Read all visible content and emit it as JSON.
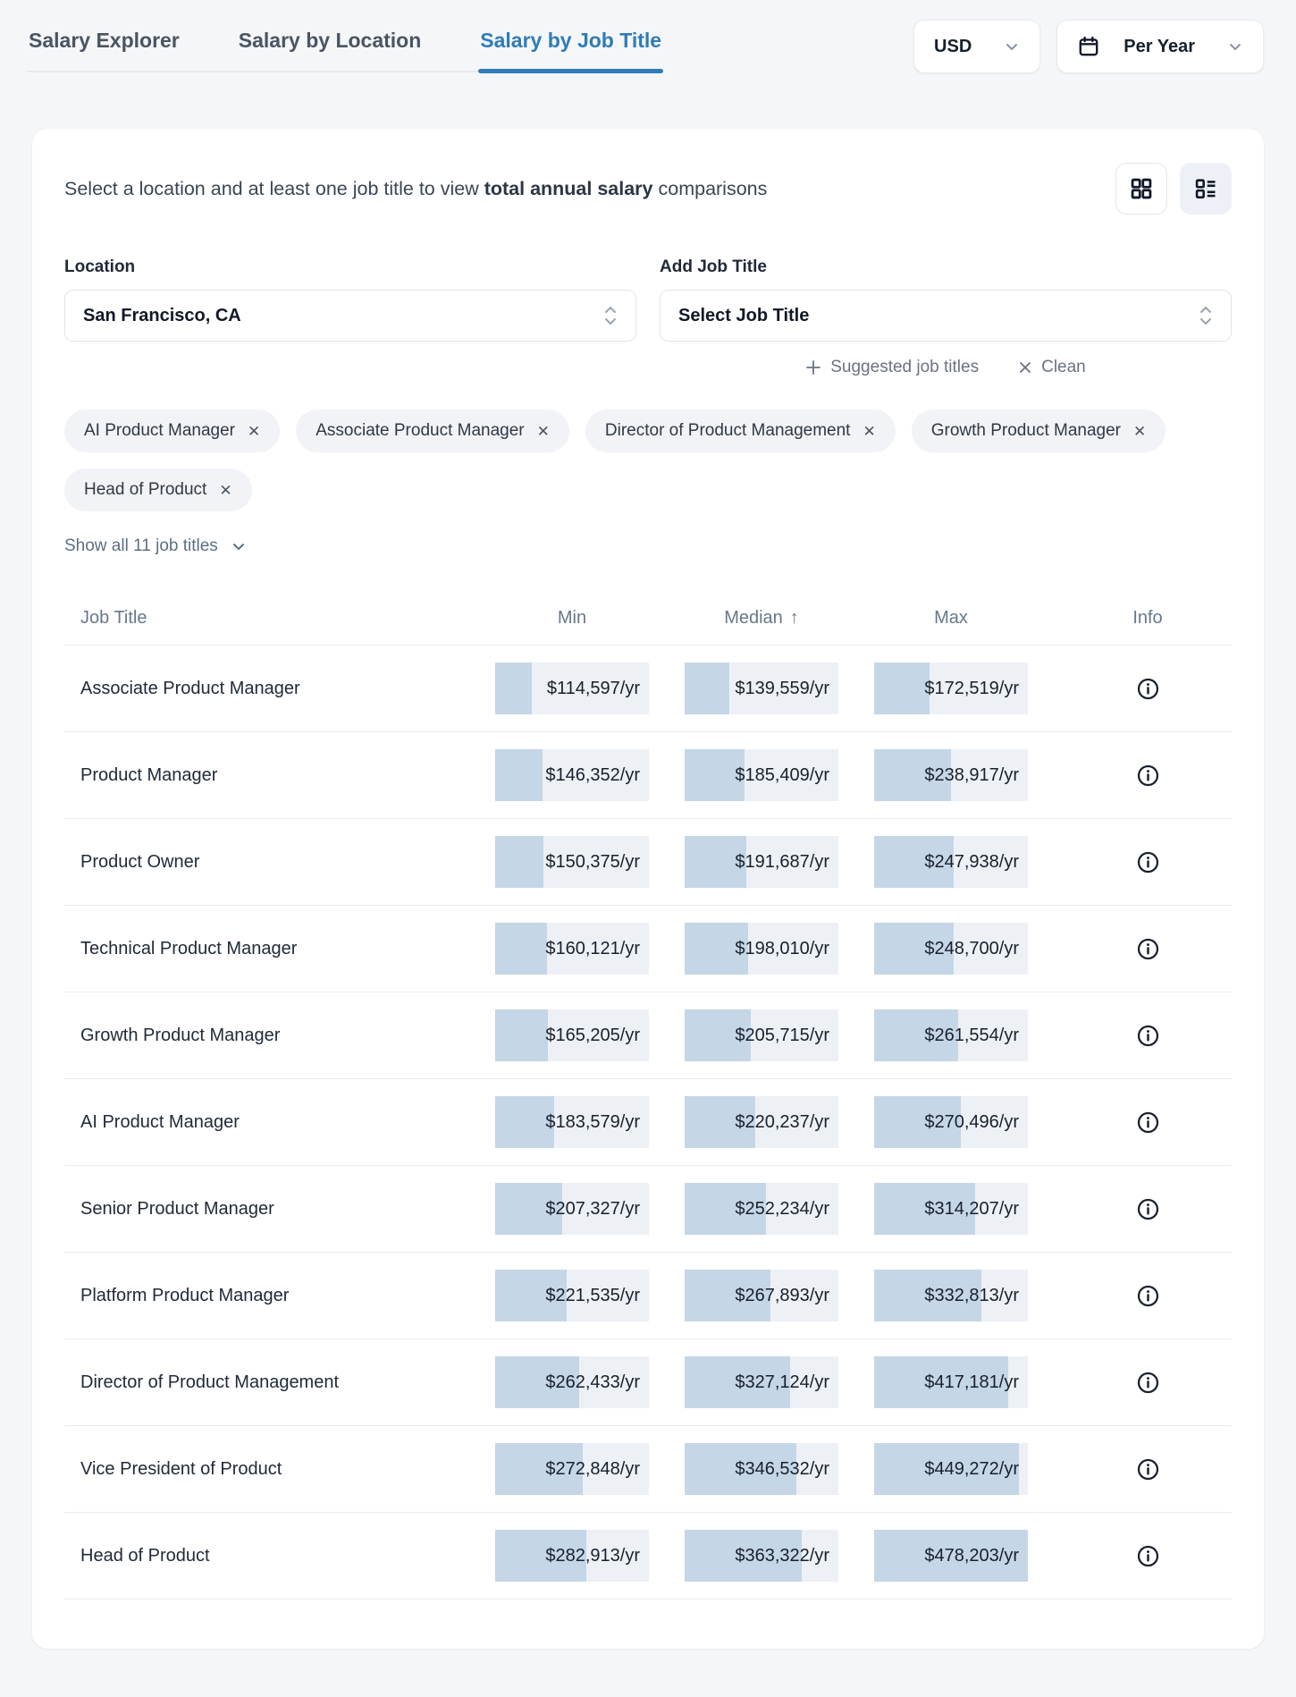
{
  "tabs": [
    {
      "label": "Salary Explorer",
      "active": false
    },
    {
      "label": "Salary by Location",
      "active": false
    },
    {
      "label": "Salary by Job Title",
      "active": true
    }
  ],
  "currency_select": {
    "value": "USD"
  },
  "period_select": {
    "value": "Per Year"
  },
  "intro": {
    "prefix": "Select a location and at least one job title to view ",
    "bold": "total annual salary",
    "suffix": " comparisons"
  },
  "filters": {
    "location": {
      "label": "Location",
      "value": "San Francisco, CA"
    },
    "job_title": {
      "label": "Add Job Title",
      "placeholder": "Select Job Title"
    },
    "suggested_link": "Suggested job titles",
    "clean_link": "Clean",
    "chips": [
      "AI Product Manager",
      "Associate Product Manager",
      "Director of Product Management",
      "Growth Product Manager",
      "Head of Product"
    ],
    "show_all": "Show all 11 job titles"
  },
  "table": {
    "columns": [
      "Job Title",
      "Min",
      "Median",
      "Max",
      "Info"
    ],
    "sort_column": "Median",
    "sort_indicator": "↑",
    "unit_suffix": "/yr",
    "max_scale": 478203,
    "rows": [
      {
        "title": "Associate Product Manager",
        "min": 114597,
        "median": 139559,
        "max": 172519,
        "min_label": "$114,597/yr",
        "median_label": "$139,559/yr",
        "max_label": "$172,519/yr"
      },
      {
        "title": "Product Manager",
        "min": 146352,
        "median": 185409,
        "max": 238917,
        "min_label": "$146,352/yr",
        "median_label": "$185,409/yr",
        "max_label": "$238,917/yr"
      },
      {
        "title": "Product Owner",
        "min": 150375,
        "median": 191687,
        "max": 247938,
        "min_label": "$150,375/yr",
        "median_label": "$191,687/yr",
        "max_label": "$247,938/yr"
      },
      {
        "title": "Technical Product Manager",
        "min": 160121,
        "median": 198010,
        "max": 248700,
        "min_label": "$160,121/yr",
        "median_label": "$198,010/yr",
        "max_label": "$248,700/yr"
      },
      {
        "title": "Growth Product Manager",
        "min": 165205,
        "median": 205715,
        "max": 261554,
        "min_label": "$165,205/yr",
        "median_label": "$205,715/yr",
        "max_label": "$261,554/yr"
      },
      {
        "title": "AI Product Manager",
        "min": 183579,
        "median": 220237,
        "max": 270496,
        "min_label": "$183,579/yr",
        "median_label": "$220,237/yr",
        "max_label": "$270,496/yr"
      },
      {
        "title": "Senior Product Manager",
        "min": 207327,
        "median": 252234,
        "max": 314207,
        "min_label": "$207,327/yr",
        "median_label": "$252,234/yr",
        "max_label": "$314,207/yr"
      },
      {
        "title": "Platform Product Manager",
        "min": 221535,
        "median": 267893,
        "max": 332813,
        "min_label": "$221,535/yr",
        "median_label": "$267,893/yr",
        "max_label": "$332,813/yr"
      },
      {
        "title": "Director of Product Management",
        "min": 262433,
        "median": 327124,
        "max": 417181,
        "min_label": "$262,433/yr",
        "median_label": "$327,124/yr",
        "max_label": "$417,181/yr"
      },
      {
        "title": "Vice President of Product",
        "min": 272848,
        "median": 346532,
        "max": 449272,
        "min_label": "$272,848/yr",
        "median_label": "$346,532/yr",
        "max_label": "$449,272/yr"
      },
      {
        "title": "Head of Product",
        "min": 282913,
        "median": 363322,
        "max": 478203,
        "min_label": "$282,913/yr",
        "median_label": "$363,322/yr",
        "max_label": "$478,203/yr"
      }
    ]
  },
  "colors": {
    "accent_blue": "#2e7cb8",
    "bar_fill": "#c5d6e6",
    "bar_track": "#edf1f6",
    "page_bg": "#f5f6f8"
  }
}
